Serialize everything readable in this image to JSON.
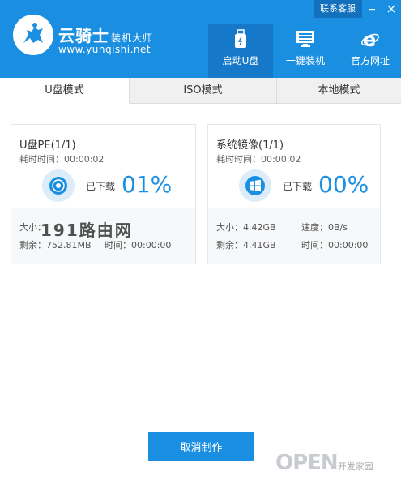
{
  "header": {
    "brand": "云骑士",
    "brand_sub": "装机大师",
    "url": "www.yunqishi.net",
    "service_label": "联系客服",
    "nav": [
      {
        "label": "启动U盘",
        "icon": "usb-drive-icon",
        "active": true
      },
      {
        "label": "一键装机",
        "icon": "monitor-icon",
        "active": false
      },
      {
        "label": "官方网址",
        "icon": "ie-browser-icon",
        "active": false
      }
    ]
  },
  "tabs": [
    {
      "label": "U盘模式",
      "active": true
    },
    {
      "label": "ISO模式",
      "active": false
    },
    {
      "label": "本地模式",
      "active": false
    }
  ],
  "cards": [
    {
      "title": "U盘PE(1/1)",
      "elapsed": "耗时时间：00:00:02",
      "icon": "disc-icon",
      "downloaded_label": "已下载",
      "percent": "01%",
      "size": "大小：",
      "speed": "",
      "remaining": "剩余：752.81MB",
      "time": "时间：00:00:00"
    },
    {
      "title": "系统镜像(1/1)",
      "elapsed": "耗时时间：00:00:02",
      "icon": "windows-icon",
      "downloaded_label": "已下载",
      "percent": "00%",
      "size": "大小：4.42GB",
      "speed": "速度：0B/s",
      "remaining": "剩余：4.41GB",
      "time": "时间：00:00:00"
    }
  ],
  "cancel_label": "取消制作",
  "watermark_left": "191路由网",
  "watermark_right": "OPEN",
  "watermark_right_sub": "开发家园",
  "colors": {
    "accent": "#1a8fe2",
    "header_dark": "#1270bc"
  }
}
